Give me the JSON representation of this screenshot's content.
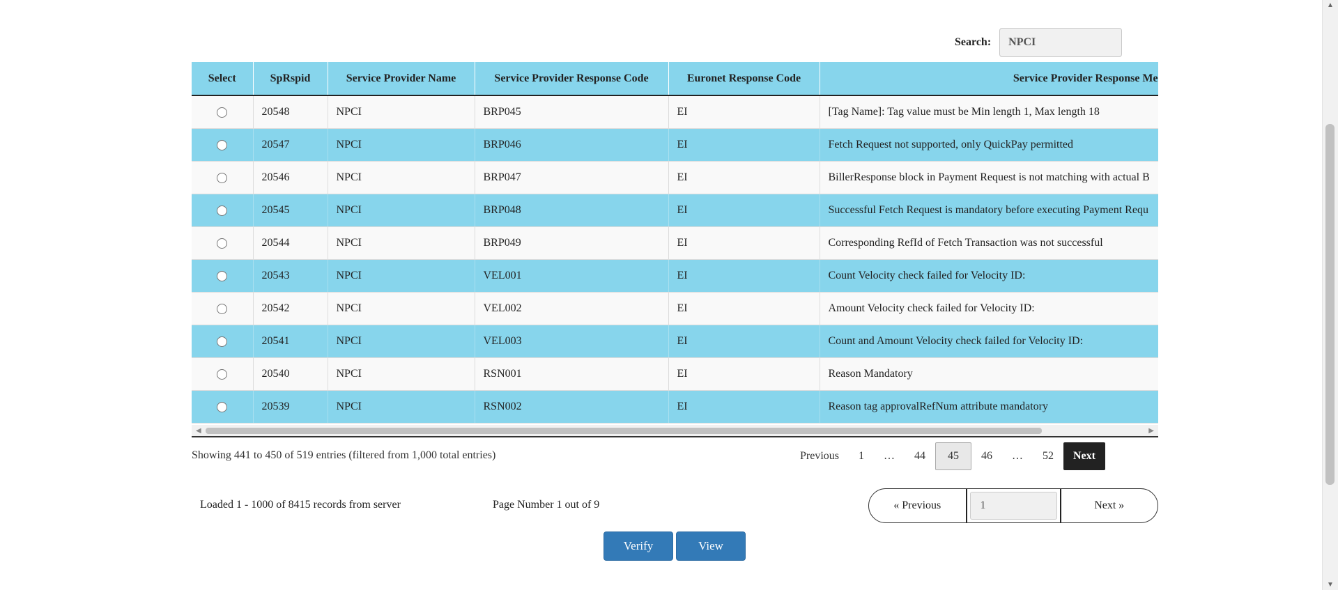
{
  "search": {
    "label": "Search:",
    "value": "NPCI"
  },
  "table": {
    "columns": [
      "Select",
      "SpRspid",
      "Service Provider Name",
      "Service Provider Response Code",
      "Euronet Response Code",
      "Service Provider Response Message"
    ],
    "rows": [
      [
        "20548",
        "NPCI",
        "BRP045",
        "EI",
        "[Tag Name]: Tag value must be Min length 1, Max length 18"
      ],
      [
        "20547",
        "NPCI",
        "BRP046",
        "EI",
        "Fetch Request not supported, only QuickPay permitted"
      ],
      [
        "20546",
        "NPCI",
        "BRP047",
        "EI",
        "BillerResponse block in Payment Request is not matching with actual B"
      ],
      [
        "20545",
        "NPCI",
        "BRP048",
        "EI",
        "Successful Fetch Request is mandatory before executing Payment Requ"
      ],
      [
        "20544",
        "NPCI",
        "BRP049",
        "EI",
        "Corresponding RefId of Fetch Transaction was not successful"
      ],
      [
        "20543",
        "NPCI",
        "VEL001",
        "EI",
        "Count Velocity check failed for Velocity ID:"
      ],
      [
        "20542",
        "NPCI",
        "VEL002",
        "EI",
        "Amount Velocity check failed for Velocity ID:"
      ],
      [
        "20541",
        "NPCI",
        "VEL003",
        "EI",
        "Count and Amount Velocity check failed for Velocity ID:"
      ],
      [
        "20540",
        "NPCI",
        "RSN001",
        "EI",
        "Reason Mandatory"
      ],
      [
        "20539",
        "NPCI",
        "RSN002",
        "EI",
        "Reason tag approvalRefNum attribute mandatory"
      ]
    ]
  },
  "info": {
    "showing": "Showing 441 to 450 of 519 entries (filtered from 1,000 total entries)"
  },
  "pager": {
    "previous": "Previous",
    "pages": [
      "1",
      "…",
      "44",
      "45",
      "46",
      "…",
      "52"
    ],
    "current": "45",
    "next": "Next"
  },
  "server": {
    "loaded": "Loaded 1 - 1000 of 8415 records from server",
    "page_number": "Page Number 1 out of 9",
    "previous": "«  Previous",
    "page_value": "1",
    "next": "Next  »"
  },
  "buttons": {
    "verify": "Verify",
    "view": "View"
  },
  "colors": {
    "row_alt": "#87d5ec",
    "primary_button": "#337ab7",
    "next_button": "#222222"
  }
}
